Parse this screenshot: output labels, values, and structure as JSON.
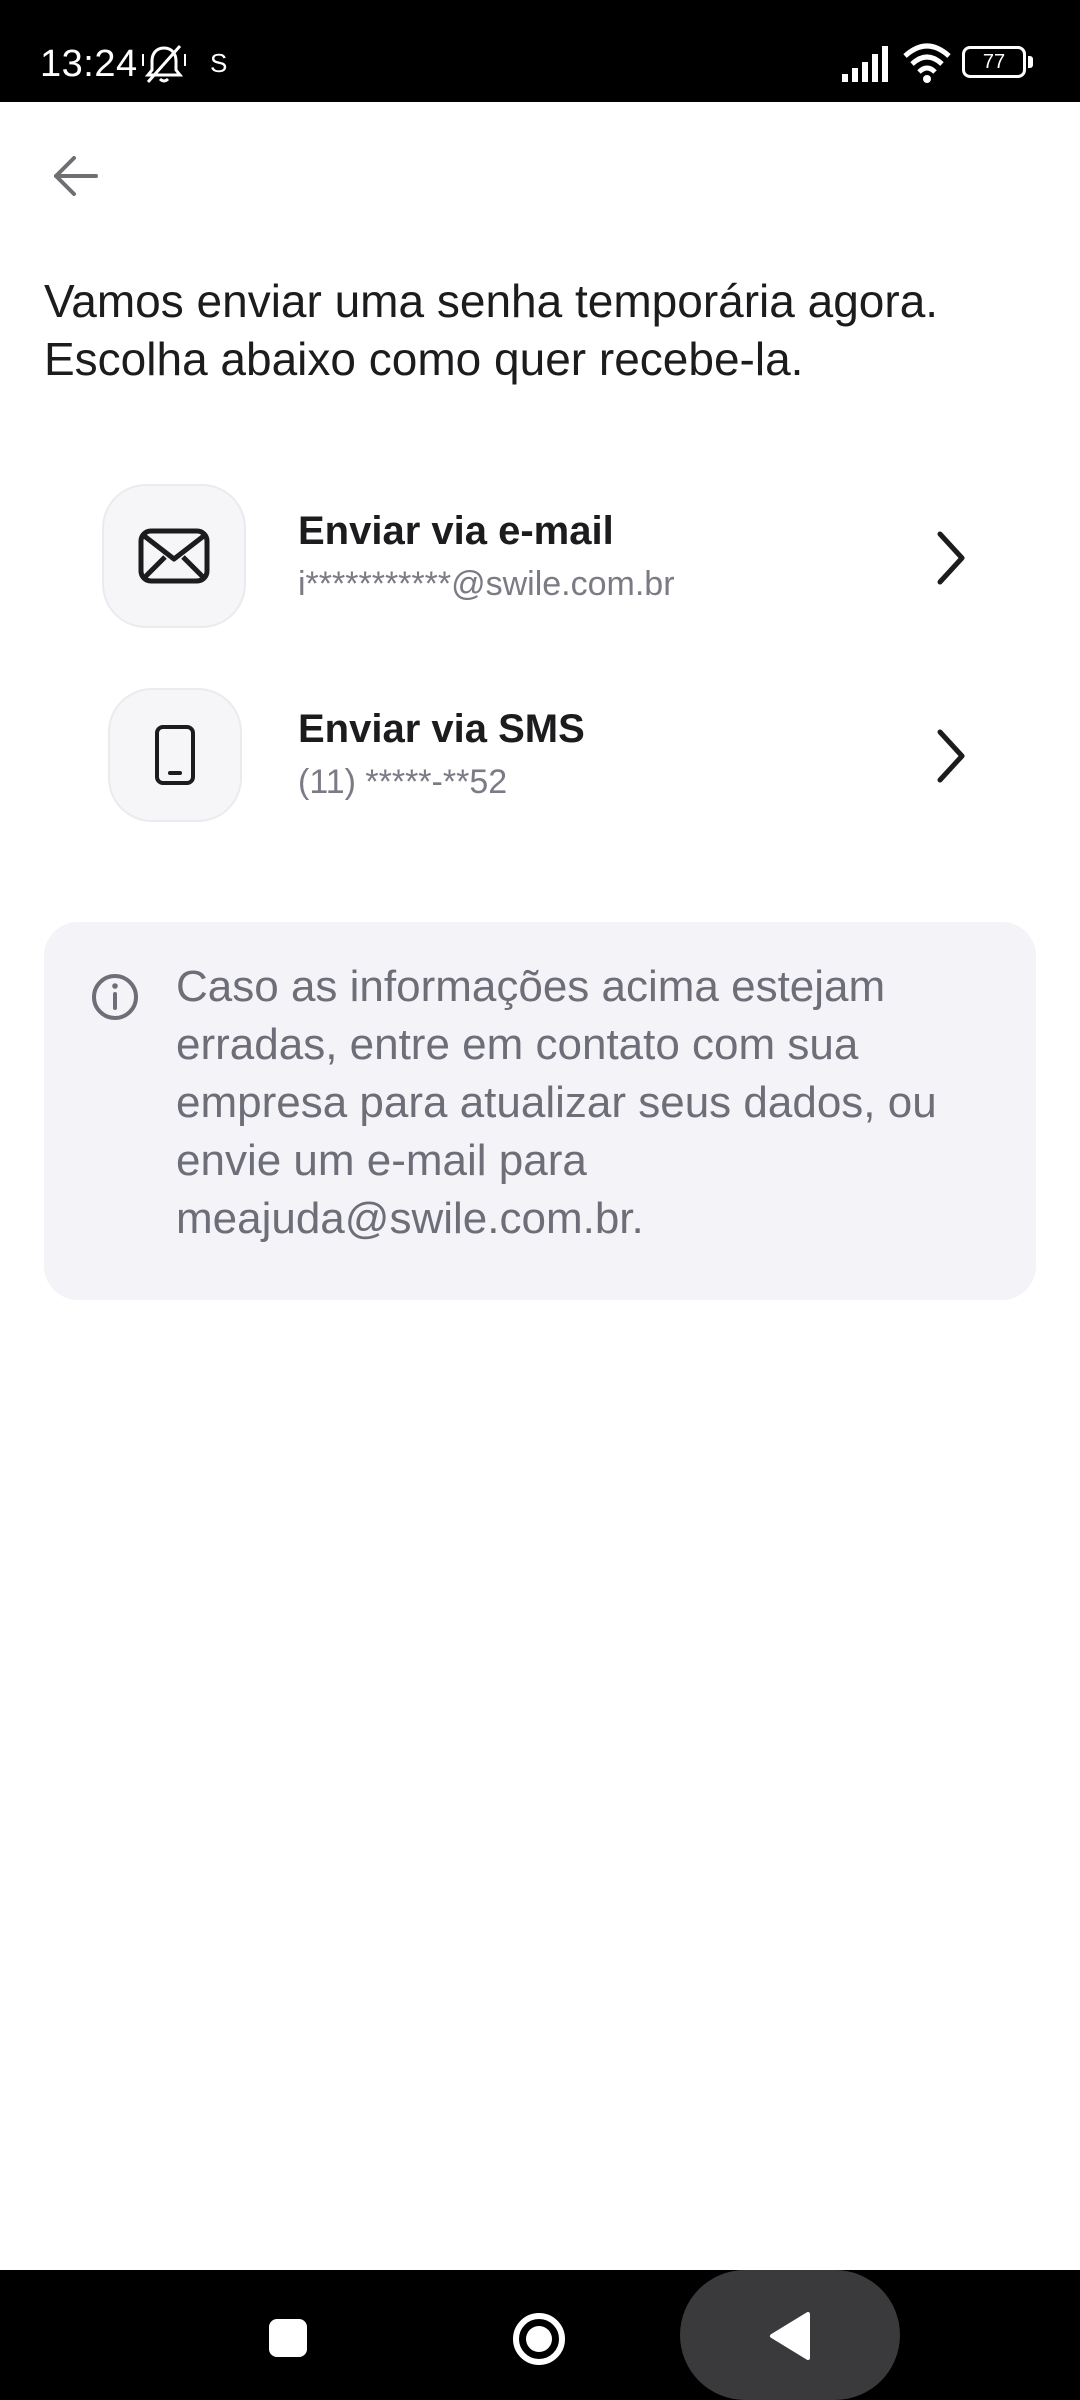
{
  "status_bar": {
    "time": "13:24",
    "carrier": "S",
    "battery": "77",
    "icons": [
      "mute-bell-icon",
      "signal-icon",
      "wifi-icon",
      "battery-icon"
    ]
  },
  "header": {
    "back_icon": "arrow-left-icon"
  },
  "intro": {
    "text": "Vamos enviar uma senha temporária agora. Escolha abaixo como quer recebe-la."
  },
  "options": [
    {
      "title": "Enviar via e-mail",
      "subtitle": "i***********@swile.com.br",
      "icon": "envelope-icon"
    },
    {
      "title": "Enviar via SMS",
      "subtitle": "(11) *****-**52",
      "icon": "phone-icon"
    }
  ],
  "info": {
    "icon": "info-icon",
    "text": "Caso as informações acima estejam erradas, entre em contato com sua empresa para atualizar seus dados, ou envie um e-mail para meajuda@swile.com.br."
  },
  "nav_bar": {
    "icons": [
      "recent-apps-icon",
      "home-icon",
      "back-icon"
    ]
  },
  "colors": {
    "text_primary": "#1c1c1e",
    "text_secondary": "#7b7b85",
    "info_bg": "#f3f3f8",
    "icon_box_bg": "#f6f6f8"
  }
}
